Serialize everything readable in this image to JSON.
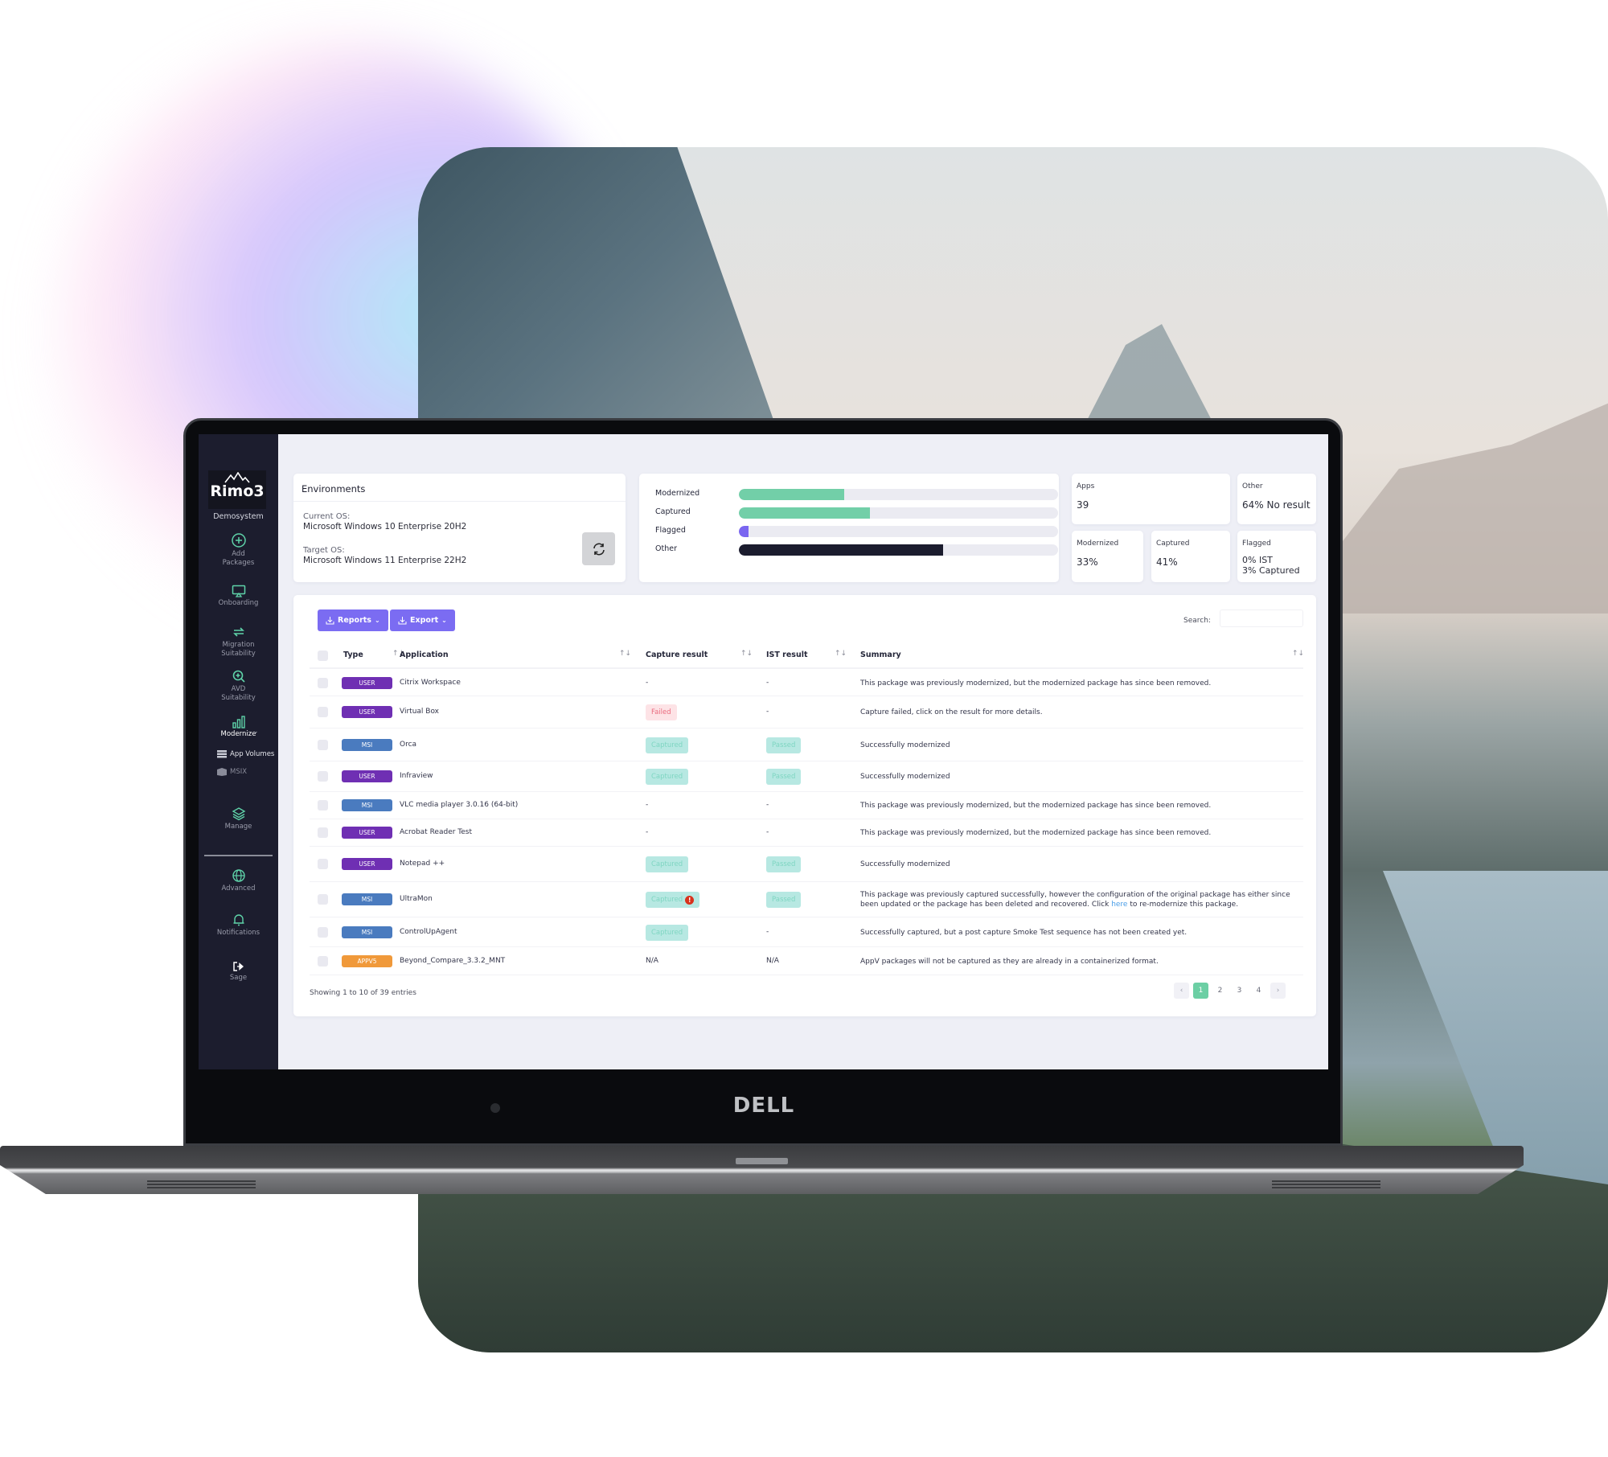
{
  "app": {
    "logo_text": "Rimo3",
    "system_name": "Demosystem",
    "device_brand": "DELL"
  },
  "sidebar": {
    "items": [
      {
        "label_line1": "Add",
        "label_line2": "Packages",
        "icon": "plus-circle-icon"
      },
      {
        "label_line1": "Onboarding",
        "label_line2": "",
        "icon": "monitor-icon"
      },
      {
        "label_line1": "Migration",
        "label_line2": "Suitability",
        "icon": "arrows-cycle-icon"
      },
      {
        "label_line1": "AVD",
        "label_line2": "Suitability",
        "icon": "zoom-plus-icon"
      },
      {
        "label_line1": "Modernize",
        "label_line2": "",
        "icon": "bar-chart-icon",
        "active": true
      },
      {
        "label_line1": "Manage",
        "label_line2": "",
        "icon": "layers-icon"
      },
      {
        "label_line1": "Advanced",
        "label_line2": "",
        "icon": "globe-icon"
      },
      {
        "label_line1": "Notifications",
        "label_line2": "",
        "icon": "bell-icon"
      },
      {
        "label_line1": "Sage",
        "label_line2": "",
        "icon": "sign-out-icon"
      }
    ],
    "subitems": [
      {
        "label": "App Volumes",
        "icon": "server-icon"
      },
      {
        "label": "MSIX",
        "icon": "box-icon"
      }
    ],
    "chevron": "⌄"
  },
  "environments": {
    "title": "Environments",
    "current_label": "Current OS:",
    "current_value": "Microsoft Windows 10 Enterprise 20H2",
    "target_label": "Target OS:",
    "target_value": "Microsoft Windows 11 Enterprise 22H2"
  },
  "progress": {
    "bars": [
      {
        "label": "Modernized",
        "percent": 33,
        "color": "#72cfa8"
      },
      {
        "label": "Captured",
        "percent": 41,
        "color": "#72cfa8"
      },
      {
        "label": "Flagged",
        "percent": 3,
        "color": "#7a66f0"
      },
      {
        "label": "Other",
        "percent": 64,
        "color": "#1b1c2e"
      }
    ]
  },
  "stats": {
    "apps": {
      "label": "Apps",
      "value": "39"
    },
    "other": {
      "label": "Other",
      "value": "64% No result"
    },
    "modernized": {
      "label": "Modernized",
      "value": "33%"
    },
    "captured": {
      "label": "Captured",
      "value": "41%"
    },
    "flagged": {
      "label": "Flagged",
      "value_line1": "0% IST",
      "value_line2": "3% Captured"
    }
  },
  "toolbar": {
    "reports_label": "Reports",
    "export_label": "Export",
    "search_label": "Search:",
    "search_value": ""
  },
  "table": {
    "columns": [
      "Type",
      "Application",
      "Capture result",
      "IST result",
      "Summary"
    ],
    "sort_glyph": "↑↓",
    "rows": [
      {
        "type": "USER",
        "application": "Citrix Workspace",
        "capture": "-",
        "capture_style": "text",
        "ist": "-",
        "ist_style": "text",
        "summary": "This package was previously modernized, but the modernized package has since been removed."
      },
      {
        "type": "USER",
        "application": "Virtual Box",
        "capture": "Failed",
        "capture_style": "failed",
        "ist": "-",
        "ist_style": "text",
        "summary": "Capture failed, click on the result for more details."
      },
      {
        "type": "MSI",
        "application": "Orca",
        "capture": "Captured",
        "capture_style": "captured",
        "ist": "Passed",
        "ist_style": "passed",
        "summary": "Successfully modernized"
      },
      {
        "type": "USER",
        "application": "Infraview",
        "capture": "Captured",
        "capture_style": "captured",
        "ist": "Passed",
        "ist_style": "passed",
        "summary": "Successfully modernized"
      },
      {
        "type": "MSI",
        "application": "VLC media player 3.0.16 (64-bit)",
        "capture": "-",
        "capture_style": "text",
        "ist": "-",
        "ist_style": "text",
        "summary": "This package was previously modernized, but the modernized package has since been removed."
      },
      {
        "type": "USER",
        "application": "Acrobat Reader Test",
        "capture": "-",
        "capture_style": "text",
        "ist": "-",
        "ist_style": "text",
        "summary": "This package was previously modernized, but the modernized package has since been removed."
      },
      {
        "type": "USER",
        "application": "Notepad ++",
        "capture": "Captured",
        "capture_style": "captured",
        "ist": "Passed",
        "ist_style": "passed",
        "summary": "Successfully modernized"
      },
      {
        "type": "MSI",
        "application": "UltraMon",
        "capture": "Captured",
        "capture_style": "captured",
        "capture_warning": true,
        "ist": "Passed",
        "ist_style": "passed",
        "summary": "This package was previously captured successfully, however the configuration of the original package has either since been updated or the package has been deleted and recovered. Click",
        "summary_link": "here",
        "summary_after": "to re-modernize this package."
      },
      {
        "type": "MSI",
        "application": "ControlUpAgent",
        "capture": "Captured",
        "capture_style": "captured",
        "ist": "-",
        "ist_style": "text",
        "summary": "Successfully captured, but a post capture Smoke Test sequence has not been created yet."
      },
      {
        "type": "APPV5",
        "application": "Beyond_Compare_3.3.2_MNT",
        "capture": "N/A",
        "capture_style": "text",
        "ist": "N/A",
        "ist_style": "text",
        "summary": "AppV packages will not be captured as they are already in a containerized format."
      }
    ],
    "type_colors": {
      "USER": "#6f2fb3",
      "MSI": "#4a7bbf",
      "APPV5": "#f0993a"
    }
  },
  "footer": {
    "showing": "Showing 1 to 10 of 39 entries",
    "pages": [
      "1",
      "2",
      "3",
      "4"
    ],
    "current_page": "1",
    "prev": "‹",
    "next": "›"
  }
}
